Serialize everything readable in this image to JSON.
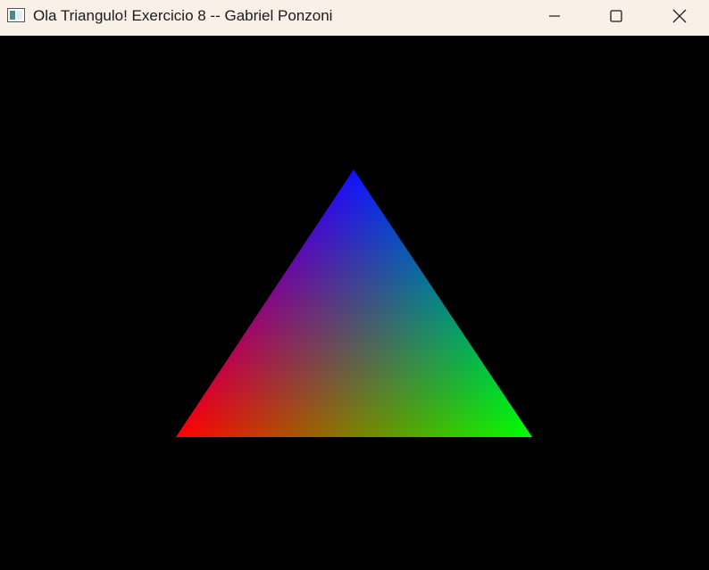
{
  "window": {
    "title": "Ola Triangulo! Exercicio 8 -- Gabriel Ponzoni",
    "icon": "opengl-window-icon",
    "controls": [
      "minimize-icon",
      "maximize-icon",
      "close-icon"
    ]
  },
  "scene": {
    "background_color": "#000000",
    "shape": "triangle",
    "vertex_colors": {
      "top": "#0000ff",
      "bottom_left": "#ff0000",
      "bottom_right": "#00ff00"
    }
  }
}
